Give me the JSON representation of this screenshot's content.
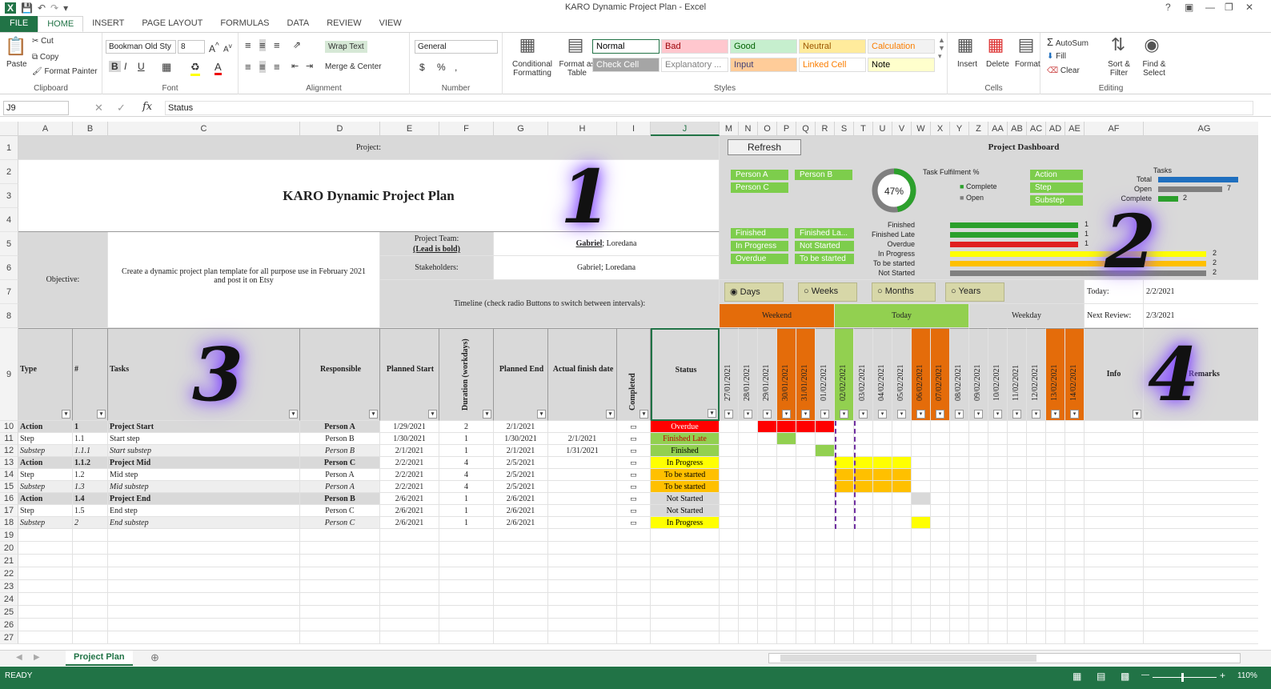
{
  "window": {
    "title": "KARO Dynamic Project Plan - Excel",
    "help": "?",
    "status_text": "READY",
    "zoom": "110%"
  },
  "ribbon_tabs": [
    "FILE",
    "HOME",
    "INSERT",
    "PAGE LAYOUT",
    "FORMULAS",
    "DATA",
    "REVIEW",
    "VIEW"
  ],
  "clipboard": {
    "paste": "Paste",
    "cut": "Cut",
    "copy": "Copy",
    "format_painter": "Format Painter",
    "label": "Clipboard"
  },
  "font": {
    "name": "Bookman Old Sty",
    "size": "8",
    "bold": "B",
    "italic": "I",
    "underline": "U",
    "label": "Font"
  },
  "alignment": {
    "wrap": "Wrap Text",
    "merge": "Merge & Center",
    "label": "Alignment"
  },
  "number": {
    "format": "General",
    "currency": "$",
    "percent": "%",
    "comma": ",",
    "label": "Number"
  },
  "styles": {
    "conditional": "Conditional Formatting",
    "format_table": "Format as Table",
    "cells": [
      {
        "name": "Normal",
        "bg": "#ffffff",
        "fg": "#000000"
      },
      {
        "name": "Bad",
        "bg": "#ffc7ce",
        "fg": "#9c0006"
      },
      {
        "name": "Good",
        "bg": "#c6efce",
        "fg": "#006100"
      },
      {
        "name": "Neutral",
        "bg": "#ffeb9c",
        "fg": "#9c5700"
      },
      {
        "name": "Calculation",
        "bg": "#f2f2f2",
        "fg": "#fa7d00"
      },
      {
        "name": "Check Cell",
        "bg": "#a5a5a5",
        "fg": "#ffffff"
      },
      {
        "name": "Explanatory ...",
        "bg": "#ffffff",
        "fg": "#7f7f7f"
      },
      {
        "name": "Input",
        "bg": "#ffcc99",
        "fg": "#3f3f76"
      },
      {
        "name": "Linked Cell",
        "bg": "#ffffff",
        "fg": "#fa7d00"
      },
      {
        "name": "Note",
        "bg": "#ffffcc",
        "fg": "#000000"
      }
    ],
    "label": "Styles"
  },
  "cells_group": {
    "insert": "Insert",
    "delete": "Delete",
    "format": "Format",
    "label": "Cells"
  },
  "editing": {
    "autosum": "AutoSum",
    "fill": "Fill",
    "clear": "Clear",
    "sort": "Sort & Filter",
    "find": "Find & Select",
    "label": "Editing"
  },
  "formula_bar": {
    "name_box": "J9",
    "fx": "fx",
    "content": "Status"
  },
  "columns": [
    "A",
    "B",
    "C",
    "D",
    "E",
    "F",
    "G",
    "H",
    "I",
    "J",
    "M",
    "N",
    "O",
    "P",
    "Q",
    "R",
    "S",
    "T",
    "U",
    "V",
    "W",
    "X",
    "Y",
    "Z",
    "AA",
    "AB",
    "AC",
    "AD",
    "AE",
    "AF",
    "AG"
  ],
  "rows": [
    "1",
    "2",
    "3",
    "4",
    "5",
    "6",
    "7",
    "8",
    "9",
    "10",
    "11",
    "12",
    "13",
    "14",
    "15",
    "16",
    "17",
    "18",
    "19",
    "20",
    "21",
    "22",
    "23",
    "24",
    "25",
    "26",
    "27"
  ],
  "sheet": {
    "project_label": "Project:",
    "title": "KARO Dynamic Project Plan",
    "objective_label": "Objective:",
    "objective": "Create a dynamic project plan template for all purpose use in February 2021 and post it on Etsy",
    "team_label": "Project Team:",
    "lead_note": "(Lead is bold)",
    "team_lead": "Gabriel",
    "team_rest": "; Loredana",
    "stakeholders_label": "Stakeholders:",
    "stakeholders": "Gabriel; Loredana",
    "timeline_label": "Timeline (check radio Buttons to switch between intervals):",
    "refresh": "Refresh",
    "dashboard_title": "Project Dashboard",
    "persons": [
      "Person A",
      "Person B",
      "Person C"
    ],
    "types": [
      "Action",
      "Step",
      "Substep"
    ],
    "statuses": [
      "Finished",
      "Finished La...",
      "In Progress",
      "Not Started",
      "Overdue",
      "To be started"
    ],
    "fulfilment_label": "Task Fulfilment %",
    "fulfilment_pct": "47%",
    "fulfilment_value": 0.47,
    "legend_complete": "Complete",
    "legend_open": "Open",
    "tasks_label": "Tasks",
    "task_bars": [
      {
        "label": "Total",
        "color": "#1f6fbf",
        "value": "",
        "frac": 1.0
      },
      {
        "label": "Open",
        "color": "#7f7f7f",
        "value": "7",
        "frac": 0.8
      },
      {
        "label": "Complete",
        "color": "#2ca02c",
        "value": "2",
        "frac": 0.25
      }
    ],
    "status_bars": [
      {
        "label": "Finished",
        "color": "#2ca02c",
        "value": "1",
        "frac": 0.5
      },
      {
        "label": "Finished Late",
        "color": "#2ca02c",
        "value": "1",
        "frac": 0.5
      },
      {
        "label": "Overdue",
        "color": "#e02020",
        "value": "1",
        "frac": 0.5
      },
      {
        "label": "In Progress",
        "color": "#ffff00",
        "value": "2",
        "frac": 1.0
      },
      {
        "label": "To be started",
        "color": "#ffc000",
        "value": "2",
        "frac": 1.0
      },
      {
        "label": "Not Started",
        "color": "#808080",
        "value": "2",
        "frac": 1.0
      }
    ],
    "intervals": [
      "Days",
      "Weeks",
      "Months",
      "Years"
    ],
    "today_label": "Today:",
    "today": "2/2/2021",
    "next_review_label": "Next Review:",
    "next_review": "2/3/2021",
    "legend_weekend": "Weekend",
    "legend_today": "Today",
    "legend_weekday": "Weekday",
    "headers": {
      "type": "Type",
      "num": "#",
      "tasks": "Tasks",
      "responsible": "Responsible",
      "planned_start": "Planned Start",
      "duration": "Duration (workdays)",
      "planned_end": "Planned End",
      "actual_finish": "Actual finish date",
      "completed": "Completed",
      "status": "Status",
      "info": "Info",
      "remarks": "Remarks"
    },
    "dates": [
      "27/01/2021",
      "28/01/2021",
      "29/01/2021",
      "30/01/2021",
      "31/01/2021",
      "01/02/2021",
      "02/02/2021",
      "03/02/2021",
      "04/02/2021",
      "05/02/2021",
      "06/02/2021",
      "07/02/2021",
      "08/02/2021",
      "09/02/2021",
      "10/02/2021",
      "11/02/2021",
      "12/02/2021",
      "13/02/2021",
      "14/02/2021"
    ],
    "tasks": [
      {
        "type": "Action",
        "num": "1",
        "task": "Project Start",
        "resp": "Person A",
        "start": "1/29/2021",
        "dur": "2",
        "end": "2/1/2021",
        "actual": "",
        "status": "Overdue"
      },
      {
        "type": "Step",
        "num": "1.1",
        "task": "Start step",
        "resp": "Person B",
        "start": "1/30/2021",
        "dur": "1",
        "end": "1/30/2021",
        "actual": "2/1/2021",
        "status": "Finished Late"
      },
      {
        "type": "Substep",
        "num": "1.1.1",
        "task": "Start substep",
        "resp": "Person B",
        "start": "2/1/2021",
        "dur": "1",
        "end": "2/1/2021",
        "actual": "1/31/2021",
        "status": "Finished"
      },
      {
        "type": "Action",
        "num": "1.1.2",
        "task": "Project Mid",
        "resp": "Person C",
        "start": "2/2/2021",
        "dur": "4",
        "end": "2/5/2021",
        "actual": "",
        "status": "In Progress"
      },
      {
        "type": "Step",
        "num": "1.2",
        "task": "Mid step",
        "resp": "Person A",
        "start": "2/2/2021",
        "dur": "4",
        "end": "2/5/2021",
        "actual": "",
        "status": "To be started"
      },
      {
        "type": "Substep",
        "num": "1.3",
        "task": "Mid substep",
        "resp": "Person A",
        "start": "2/2/2021",
        "dur": "4",
        "end": "2/5/2021",
        "actual": "",
        "status": "To be started"
      },
      {
        "type": "Action",
        "num": "1.4",
        "task": "Project End",
        "resp": "Person B",
        "start": "2/6/2021",
        "dur": "1",
        "end": "2/6/2021",
        "actual": "",
        "status": "Not Started"
      },
      {
        "type": "Step",
        "num": "1.5",
        "task": "End step",
        "resp": "Person C",
        "start": "2/6/2021",
        "dur": "1",
        "end": "2/6/2021",
        "actual": "",
        "status": "Not Started"
      },
      {
        "type": "Substep",
        "num": "2",
        "task": "End substep",
        "resp": "Person C",
        "start": "2/6/2021",
        "dur": "1",
        "end": "2/6/2021",
        "actual": "",
        "status": "In Progress"
      }
    ],
    "status_colors": {
      "Overdue": {
        "bg": "#ff0000",
        "fg": "#ffffff"
      },
      "Finished Late": {
        "bg": "#92d050",
        "fg": "#c00000"
      },
      "Finished": {
        "bg": "#92d050",
        "fg": "#000000"
      },
      "In Progress": {
        "bg": "#ffff00",
        "fg": "#000000"
      },
      "To be started": {
        "bg": "#ffc000",
        "fg": "#000000"
      },
      "Not Started": {
        "bg": "#d9d9d9",
        "fg": "#000000"
      }
    },
    "annotations": [
      "1",
      "2",
      "3",
      "4"
    ]
  },
  "sheet_tab": "Project Plan"
}
